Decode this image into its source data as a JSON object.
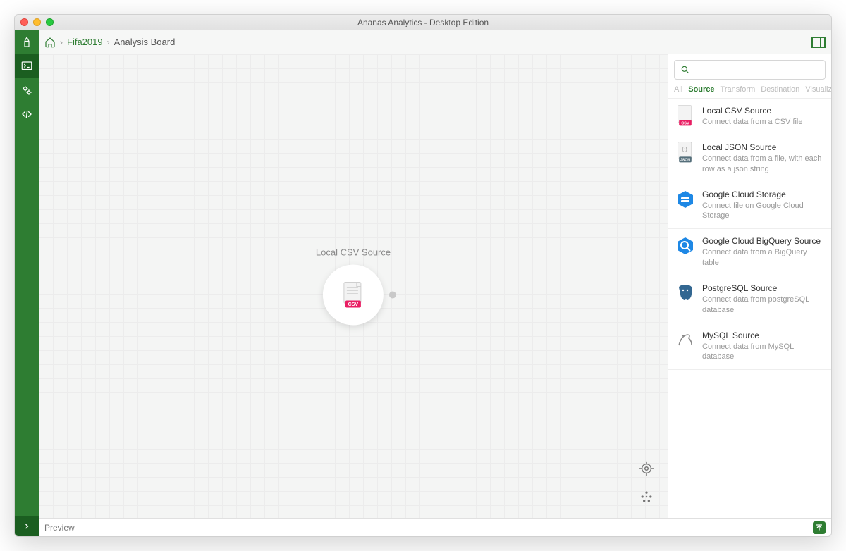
{
  "window": {
    "title": "Ananas Analytics - Desktop Edition"
  },
  "breadcrumb": {
    "project": "Fifa2019",
    "board": "Analysis Board"
  },
  "canvas": {
    "node_title": "Local CSV Source"
  },
  "search": {
    "placeholder": ""
  },
  "tabs": {
    "all": "All",
    "source": "Source",
    "transform": "Transform",
    "destination": "Destination",
    "visualization": "Visualization",
    "active": "source"
  },
  "sources": [
    {
      "title": "Local CSV Source",
      "desc": "Connect data from a CSV file",
      "icon": "csv"
    },
    {
      "title": "Local JSON Source",
      "desc": "Connect data from a file, with each row as a json string",
      "icon": "json"
    },
    {
      "title": "Google Cloud Storage",
      "desc": "Connect file on Google Cloud Storage",
      "icon": "gcs"
    },
    {
      "title": "Google Cloud BigQuery Source",
      "desc": "Connect data from a BigQuery table",
      "icon": "bq"
    },
    {
      "title": "PostgreSQL Source",
      "desc": "Connect data from postgreSQL database",
      "icon": "postgres"
    },
    {
      "title": "MySQL Source",
      "desc": "Connect data from MySQL database",
      "icon": "mysql"
    }
  ],
  "bottom": {
    "preview": "Preview"
  }
}
